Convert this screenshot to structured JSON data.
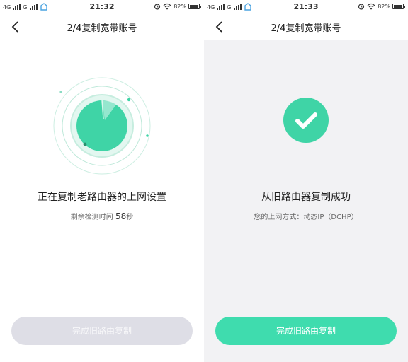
{
  "colors": {
    "accent": "#3fd4a6",
    "button_active": "#3fdcae",
    "button_disabled": "#dedee6"
  },
  "left": {
    "status": {
      "network1": "4G",
      "network2": "G",
      "time": "21:32",
      "battery": "82%"
    },
    "nav": {
      "title": "2/4复制宽带账号",
      "back_icon": "chevron-left-icon"
    },
    "headline": "正在复制老路由器的上网设置",
    "sub_prefix": "剩余检测时间",
    "sub_seconds": "58",
    "sub_suffix": "秒",
    "button_label": "完成旧路由复制"
  },
  "right": {
    "status": {
      "network1": "4G",
      "network2": "G",
      "time": "21:33",
      "battery": "82%"
    },
    "nav": {
      "title": "2/4复制宽带账号",
      "back_icon": "chevron-left-icon"
    },
    "headline": "从旧路由器复制成功",
    "sub": "您的上网方式：动态IP（DCHP）",
    "button_label": "完成旧路由复制"
  }
}
